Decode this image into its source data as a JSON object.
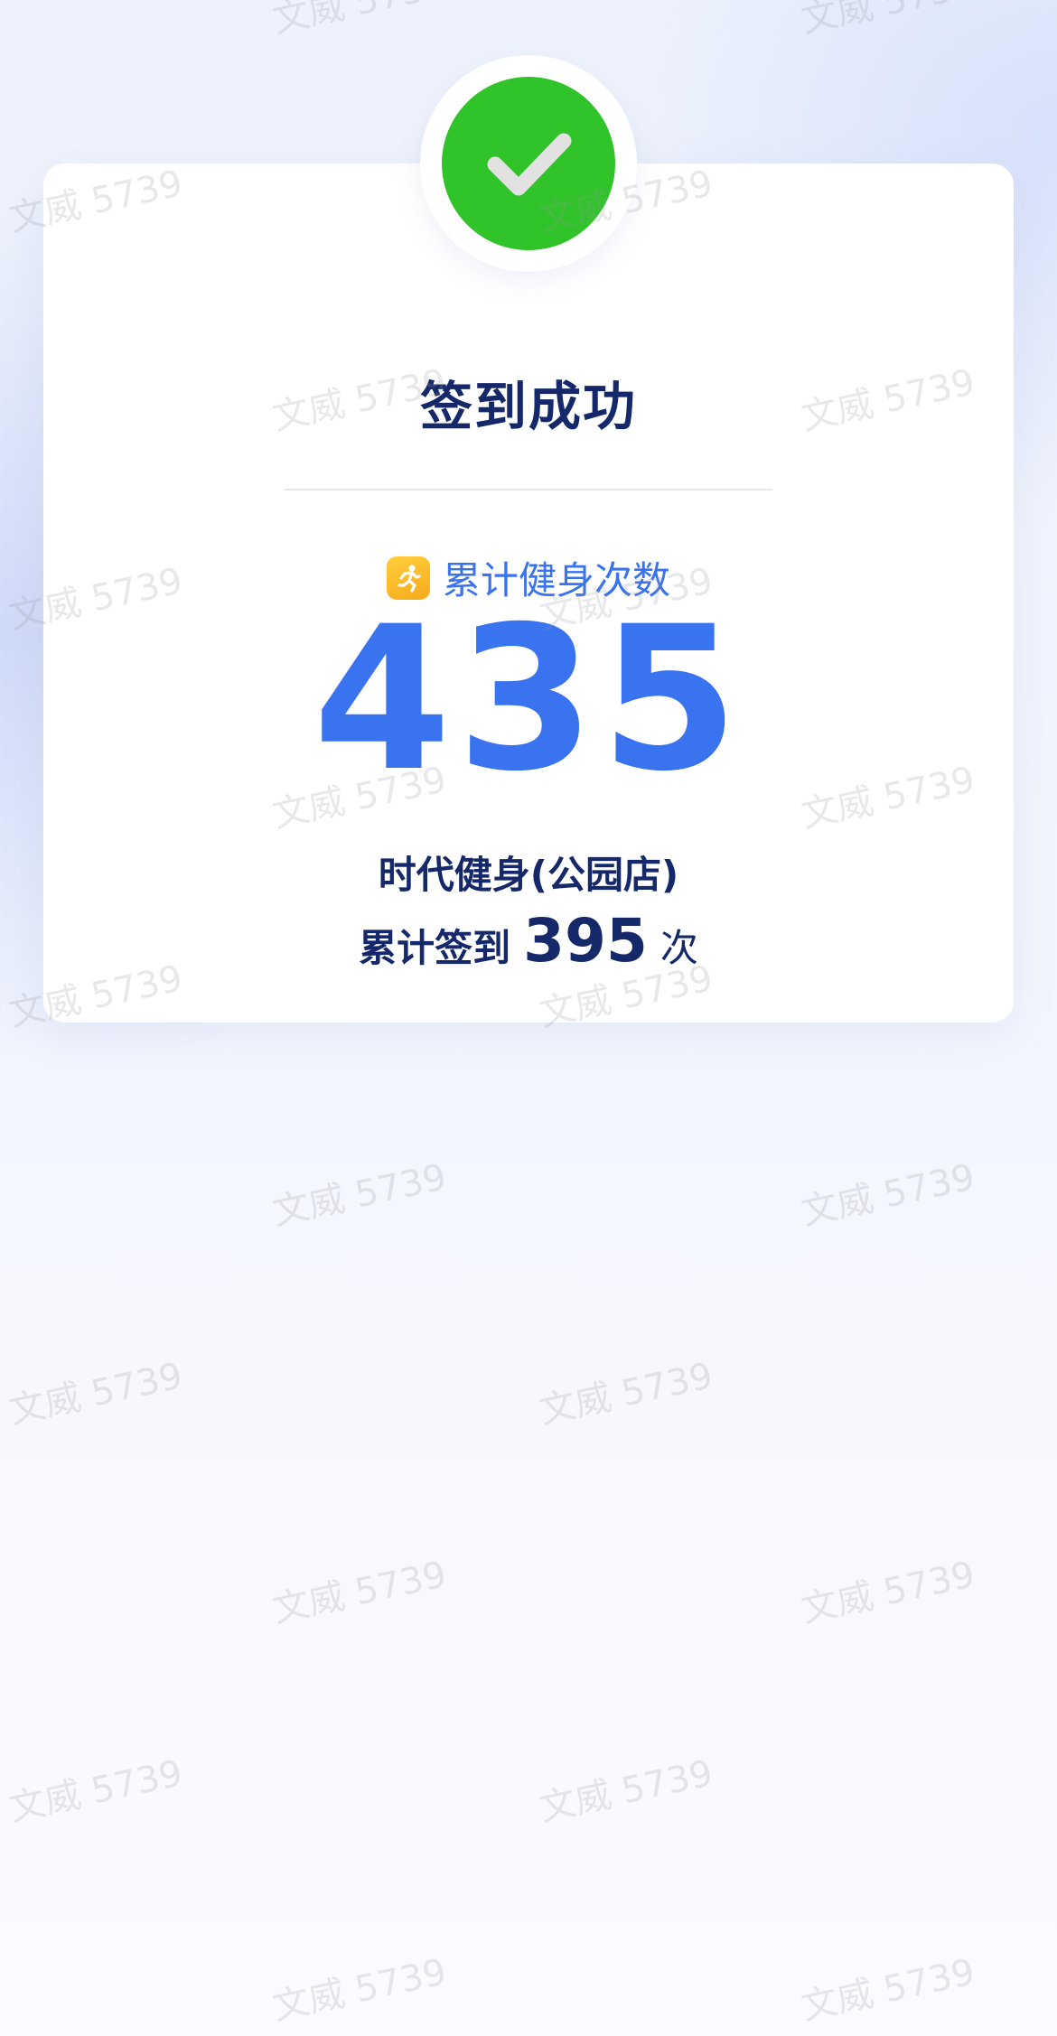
{
  "checkin": {
    "title": "签到成功",
    "stat_label": "累计健身次数",
    "stat_value": "435",
    "store_name": "时代健身(公园店)",
    "checkin_prefix": "累计签到",
    "checkin_count": "395",
    "checkin_suffix": "次"
  },
  "watermark": {
    "text": "文威 5739"
  },
  "colors": {
    "success_green": "#31c42a",
    "accent_blue": "#3a73f0",
    "title_navy": "#15296a",
    "icon_orange": "#f6a91a"
  },
  "icons": {
    "badge": "check-icon",
    "stat": "running-person-icon"
  }
}
